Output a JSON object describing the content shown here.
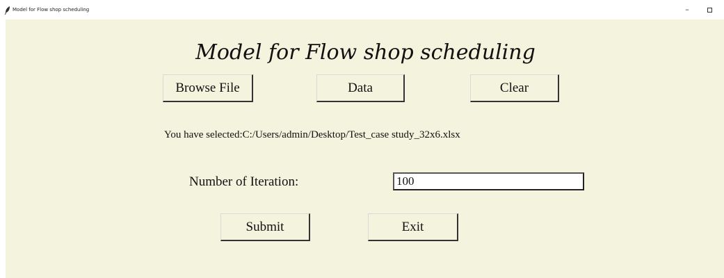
{
  "window": {
    "title": "Model for Flow shop scheduling",
    "minimize_glyph": "–",
    "app_icon": "feather-icon"
  },
  "heading": "Model for Flow shop scheduling",
  "buttons": {
    "browse": "Browse File",
    "data": "Data",
    "clear": "Clear",
    "submit": "Submit",
    "exit": "Exit"
  },
  "selected_file_text": "You have selected:C:/Users/admin/Desktop/Test_case study_32x6.xlsx",
  "iteration": {
    "label": "Number of Iteration:",
    "value": "100"
  },
  "colors": {
    "background": "#f4f3dd",
    "text": "#111111"
  }
}
